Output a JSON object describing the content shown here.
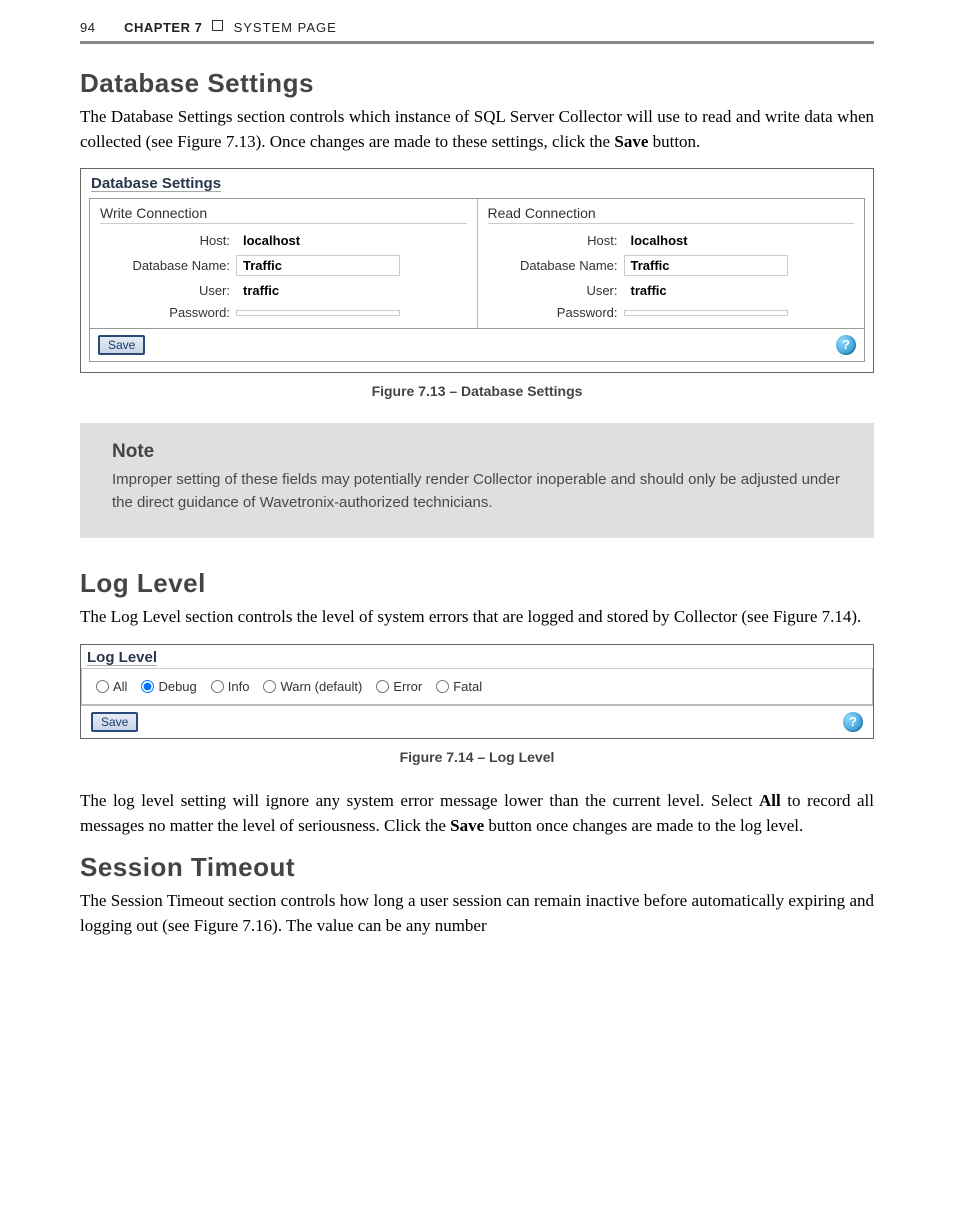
{
  "runningHead": {
    "pageNumber": "94",
    "chapter": "CHAPTER 7",
    "section": "SYSTEM PAGE"
  },
  "sections": {
    "db": {
      "heading": "Database Settings",
      "para": "The Database Settings section controls which instance of SQL Server Collector will use to read and write data when collected (see Figure 7.13). Once changes are made to these settings, click the ",
      "paraBold": "Save",
      "paraEnd": " button."
    },
    "dbPanel": {
      "title": "Database Settings",
      "write": {
        "title": "Write Connection",
        "hostLabel": "Host:",
        "host": "localhost",
        "dbLabel": "Database Name:",
        "db": "Traffic",
        "userLabel": "User:",
        "user": "traffic",
        "pwLabel": "Password:",
        "pw": ""
      },
      "read": {
        "title": "Read Connection",
        "hostLabel": "Host:",
        "host": "localhost",
        "dbLabel": "Database Name:",
        "db": "Traffic",
        "userLabel": "User:",
        "user": "traffic",
        "pwLabel": "Password:",
        "pw": ""
      },
      "save": "Save",
      "help": "?"
    },
    "figcap1": "Figure 7.13 – Database Settings",
    "note": {
      "title": "Note",
      "body": "Improper setting of these fields may potentially render Collector inoperable and should only be adjusted under the direct guidance of Wavetronix-authorized technicians."
    },
    "log": {
      "heading": "Log Level",
      "para": "The Log Level section controls the level of system errors that are logged and stored by Collector (see Figure 7.14)."
    },
    "logPanel": {
      "title": "Log Level",
      "options": {
        "all": "All",
        "debug": "Debug",
        "info": "Info",
        "warn": "Warn (default)",
        "error": "Error",
        "fatal": "Fatal"
      },
      "selected": "debug",
      "save": "Save",
      "help": "?"
    },
    "figcap2": "Figure 7.14 – Log Level",
    "logPara2a": "The log level setting will ignore any system error message lower than the current level. Select ",
    "logPara2b": "All",
    "logPara2c": " to record all messages no matter the level of seriousness. Click the ",
    "logPara2d": "Save",
    "logPara2e": " button once changes are made to the log level.",
    "session": {
      "heading": "Session Timeout",
      "para": "The Session Timeout section controls how long a user session can remain inactive before automatically expiring and logging out (see Figure 7.16). The value can be any number"
    }
  }
}
